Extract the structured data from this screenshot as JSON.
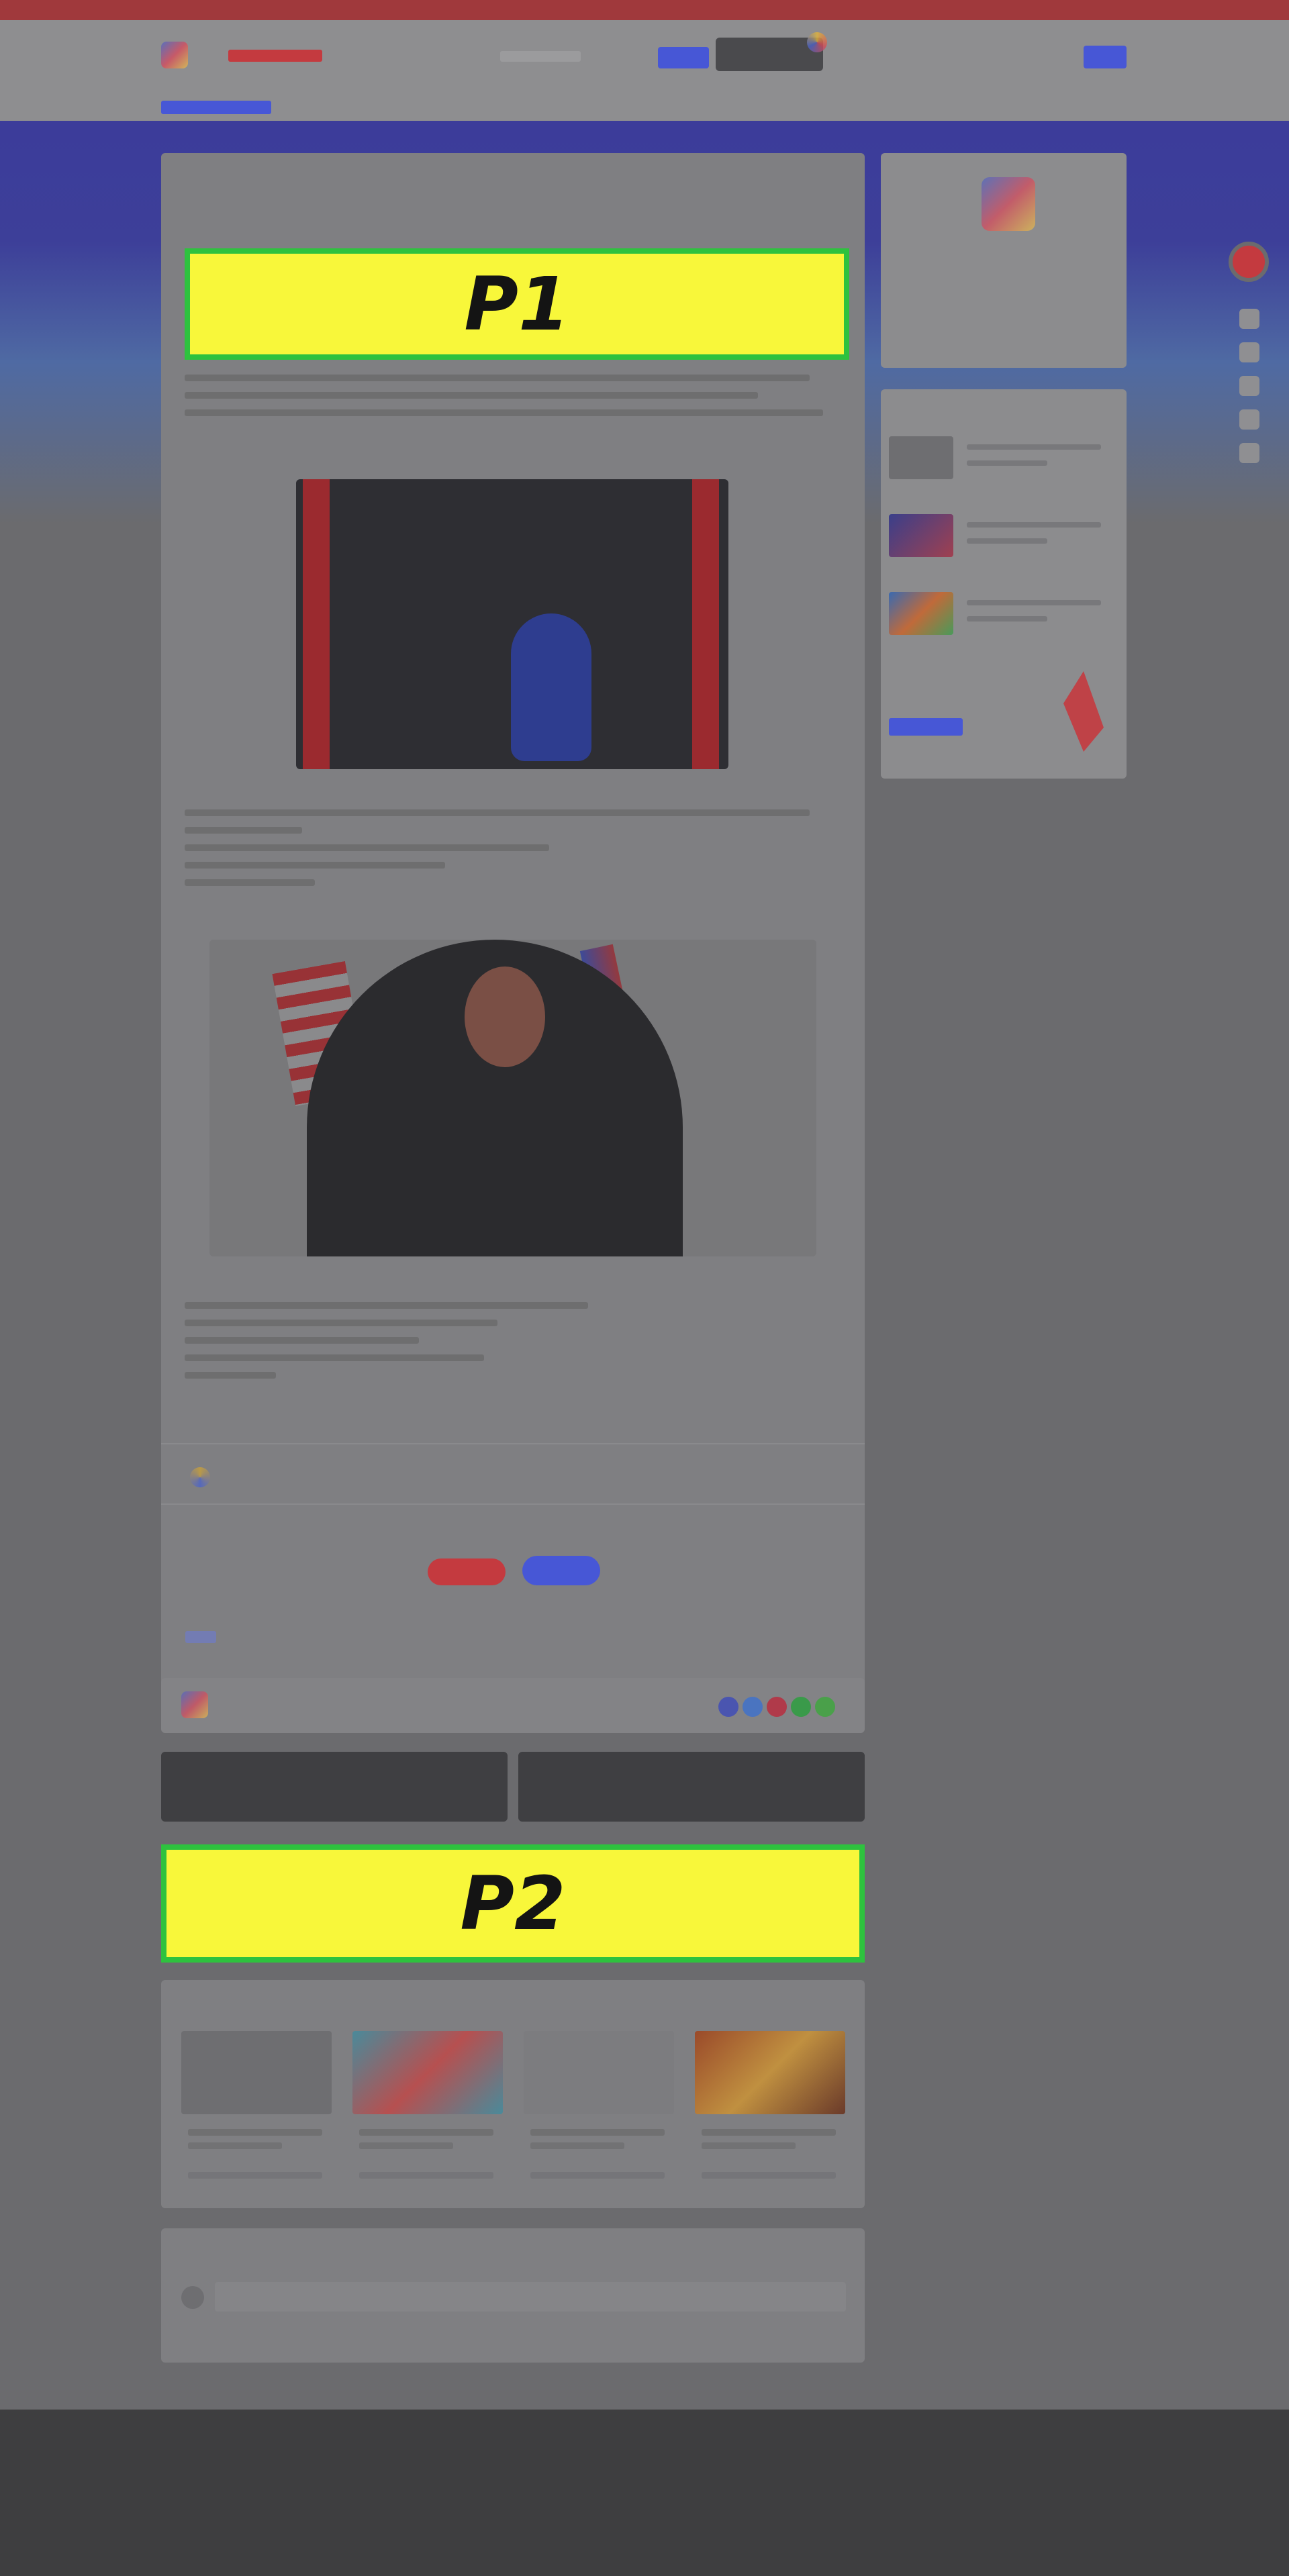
{
  "ads": {
    "p1_label": "P1",
    "p2_label": "P2"
  },
  "colors": {
    "topbar": "#a0393c",
    "accent_blue": "#4757d6",
    "accent_red": "#c43a3f",
    "ad_fill": "#f8f73a",
    "ad_border": "#2ec23e",
    "footer": "#3e3e40"
  }
}
